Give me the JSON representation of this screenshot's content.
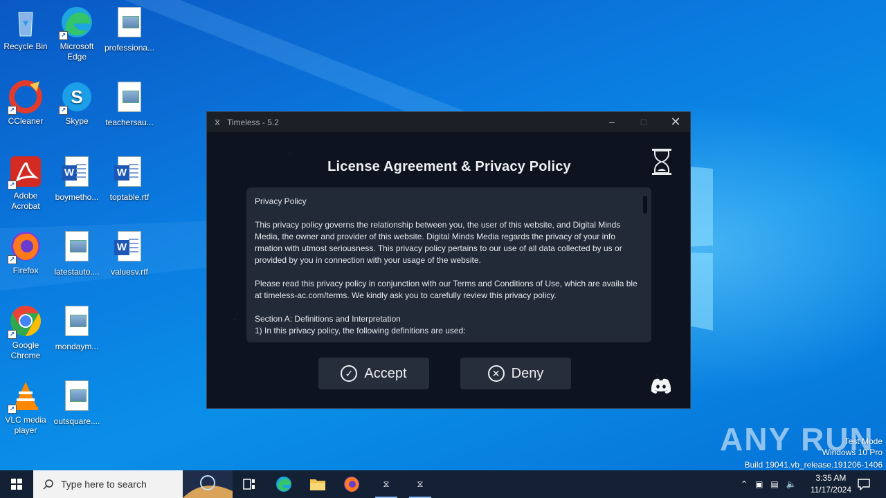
{
  "desktop": {
    "icons": [
      {
        "label": "Recycle Bin"
      },
      {
        "label": "Microsoft Edge"
      },
      {
        "label": "professiona..."
      },
      {
        "label": "CCleaner"
      },
      {
        "label": "Skype"
      },
      {
        "label": "teachersau..."
      },
      {
        "label": "Adobe Acrobat"
      },
      {
        "label": "boymetho..."
      },
      {
        "label": "toptable.rtf"
      },
      {
        "label": "Firefox"
      },
      {
        "label": "latestauto...."
      },
      {
        "label": "valuesv.rtf"
      },
      {
        "label": "Google Chrome"
      },
      {
        "label": "mondaym..."
      },
      {
        "label": "VLC media player"
      },
      {
        "label": "outsquare...."
      }
    ]
  },
  "window": {
    "title": "Timeless - 5.2",
    "heading": "License Agreement &  Privacy Policy",
    "policy": {
      "heading": "Privacy Policy",
      "paragraph1": "This privacy policy governs the relationship between you, the user of this website, and Digital Minds Media, the owner and provider of this website. Digital Minds Media regards the privacy of your info rmation with utmost seriousness. This privacy policy pertains to our use of all data collected by us or provided by you in connection with your usage of the website.",
      "paragraph2": "Please read this privacy policy in conjunction with our Terms and Conditions of Use, which are availa ble at timeless-ac.com/terms. We kindly ask you to carefully review this privacy policy.",
      "section_title": "Section A: Definitions and Interpretation",
      "section_line": "1) In this privacy policy, the following definitions are used:"
    },
    "accept_label": "Accept",
    "deny_label": "Deny"
  },
  "watermark": {
    "brand": "ANY RUN",
    "line1": "Test Mode",
    "line2": "Windows 10 Pro",
    "line3": "Build 19041.vb_release.191206-1406"
  },
  "taskbar": {
    "search_placeholder": "Type here to search",
    "time": "3:35 AM",
    "date": "11/17/2024"
  },
  "colors": {
    "desktop_blue": "#0a7be0",
    "window_bg": "#0d1420",
    "panel_bg": "#222a37",
    "taskbar_bg": "#142033"
  }
}
